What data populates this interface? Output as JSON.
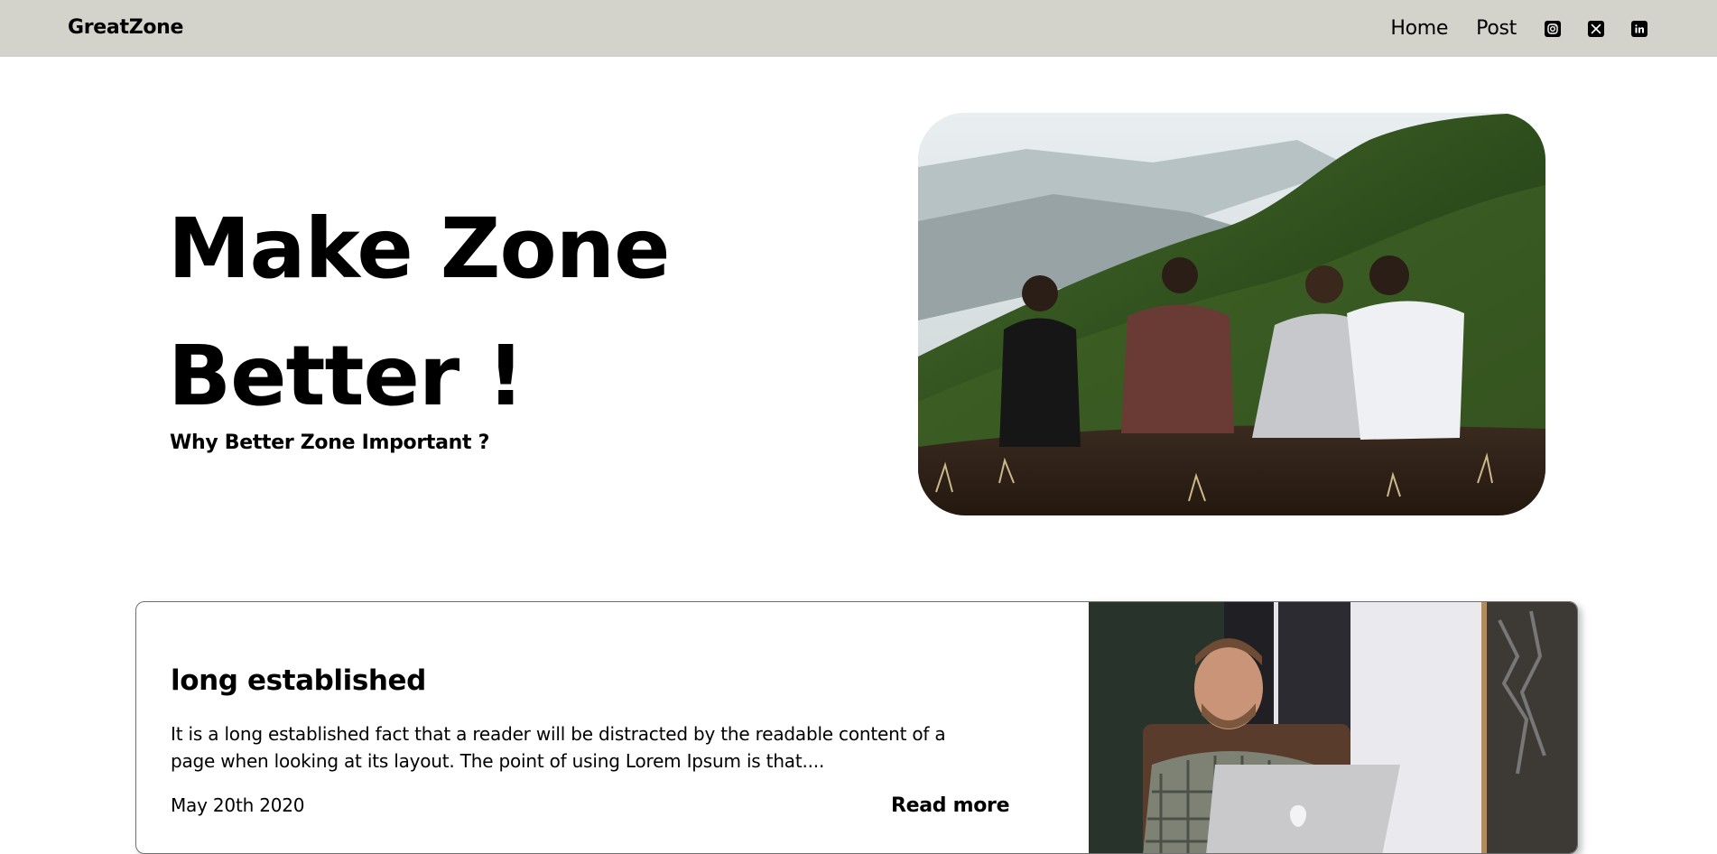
{
  "brand": {
    "name": "GreatZone"
  },
  "nav": {
    "links": [
      {
        "label": "Home"
      },
      {
        "label": "Post"
      }
    ],
    "socials": [
      {
        "icon": "instagram-icon"
      },
      {
        "icon": "x-twitter-icon"
      },
      {
        "icon": "linkedin-icon"
      }
    ]
  },
  "hero": {
    "title_line1": "Make Zone",
    "title_line2": "Better !",
    "subtitle": "Why Better Zone Important ?",
    "image_alt": "friends-sitting-on-hill-photo"
  },
  "post": {
    "title": "long established",
    "excerpt": "It is a long established fact that a reader will be distracted by the readable content of a page when looking at its layout. The point of using Lorem Ipsum is that....",
    "date": "May 20th 2020",
    "read_more_label": "Read more",
    "image_alt": "man-with-laptop-photo"
  },
  "colors": {
    "navbar_bg": "#d3d3cc",
    "text": "#000000",
    "page_bg": "#ffffff"
  }
}
